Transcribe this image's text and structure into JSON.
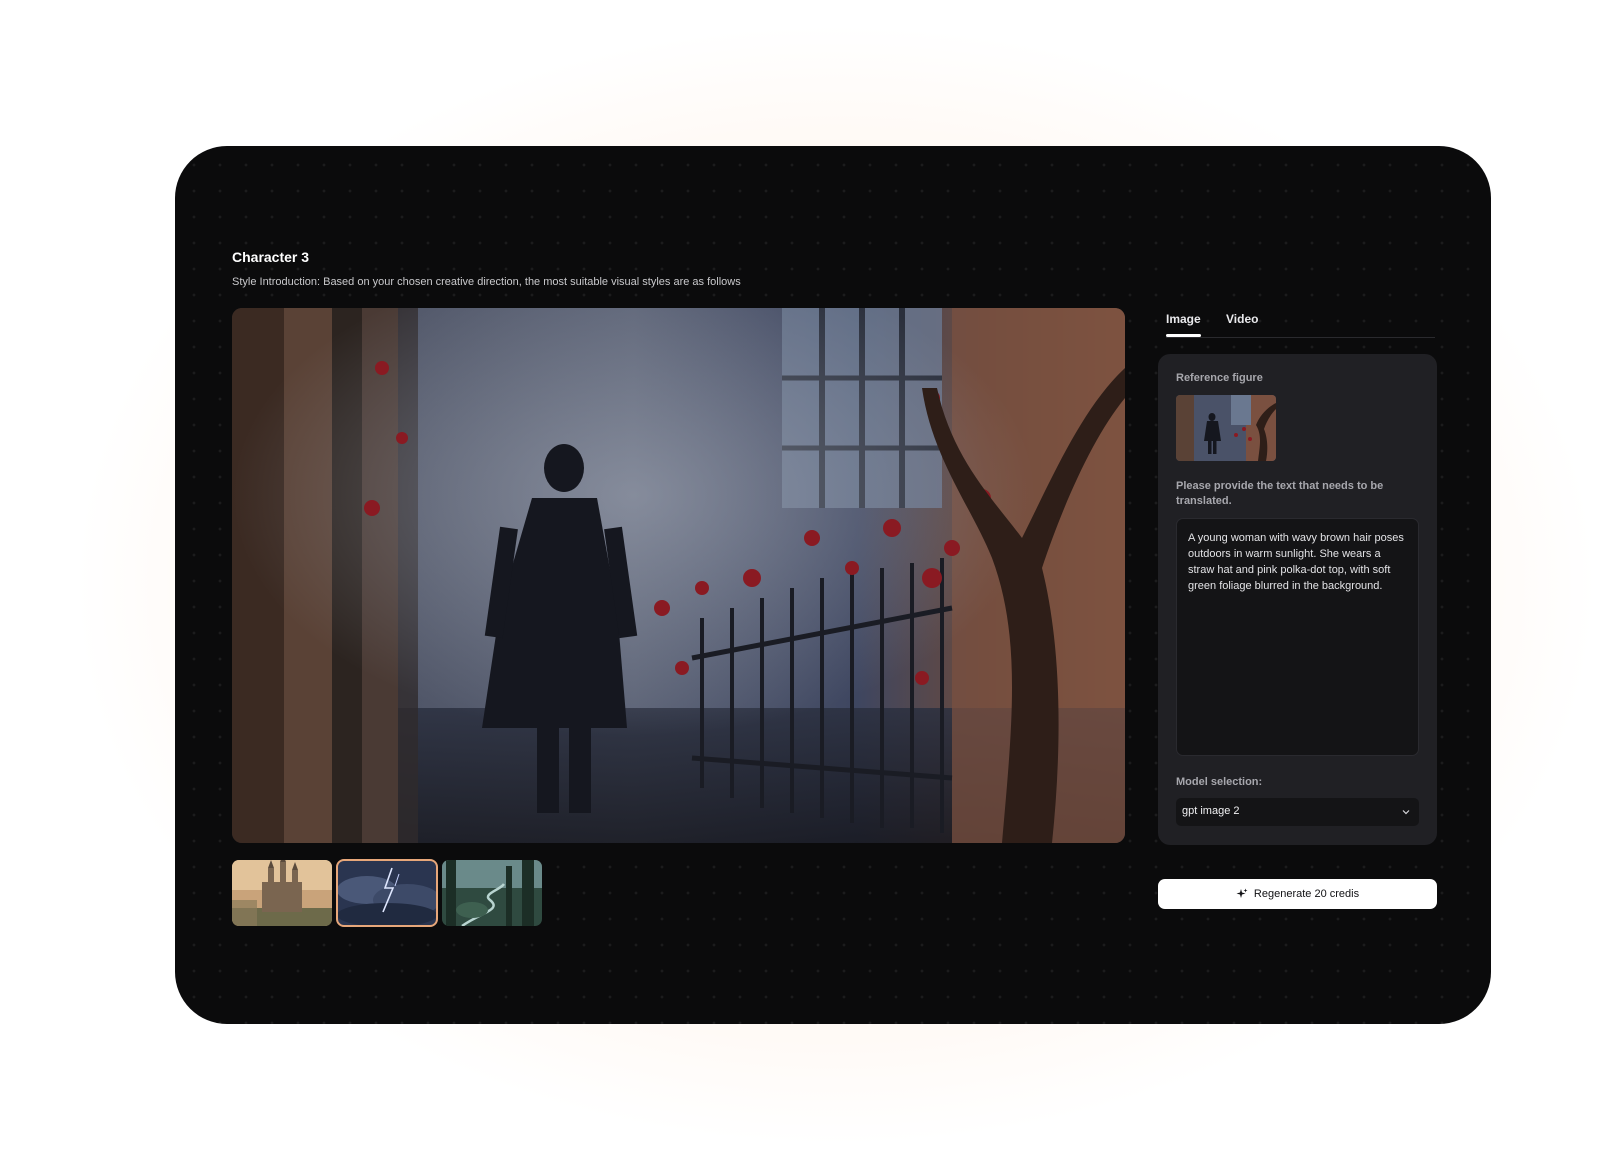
{
  "header": {
    "title": "Character 3",
    "subtitle": "Style Introduction: Based on your chosen creative direction, the most suitable visual styles are as follows"
  },
  "tabs": [
    {
      "label": "Image",
      "active": true
    },
    {
      "label": "Video",
      "active": false
    }
  ],
  "panel": {
    "reference_label": "Reference figure",
    "prompt_label": "Please provide the text that needs to be translated.",
    "prompt_text": "A young woman with wavy brown hair poses outdoors in warm sunlight. She wears a straw hat and pink polka-dot top, with soft green foliage blurred in the background.",
    "model_label": "Model selection:",
    "model_value": "gpt image 2"
  },
  "regenerate_label": "Regenerate 20 credis",
  "icons": {
    "regenerate": "sparkle-icon",
    "select": "chevron-down-icon"
  },
  "colors": {
    "app_background": "#0b0b0c",
    "panel_background": "#202024",
    "selected_thumb_border": "#e7a77a",
    "button_background": "#ffffff"
  },
  "thumbnails": [
    {
      "name": "castle",
      "selected": false
    },
    {
      "name": "storm",
      "selected": true
    },
    {
      "name": "forest",
      "selected": false
    }
  ]
}
